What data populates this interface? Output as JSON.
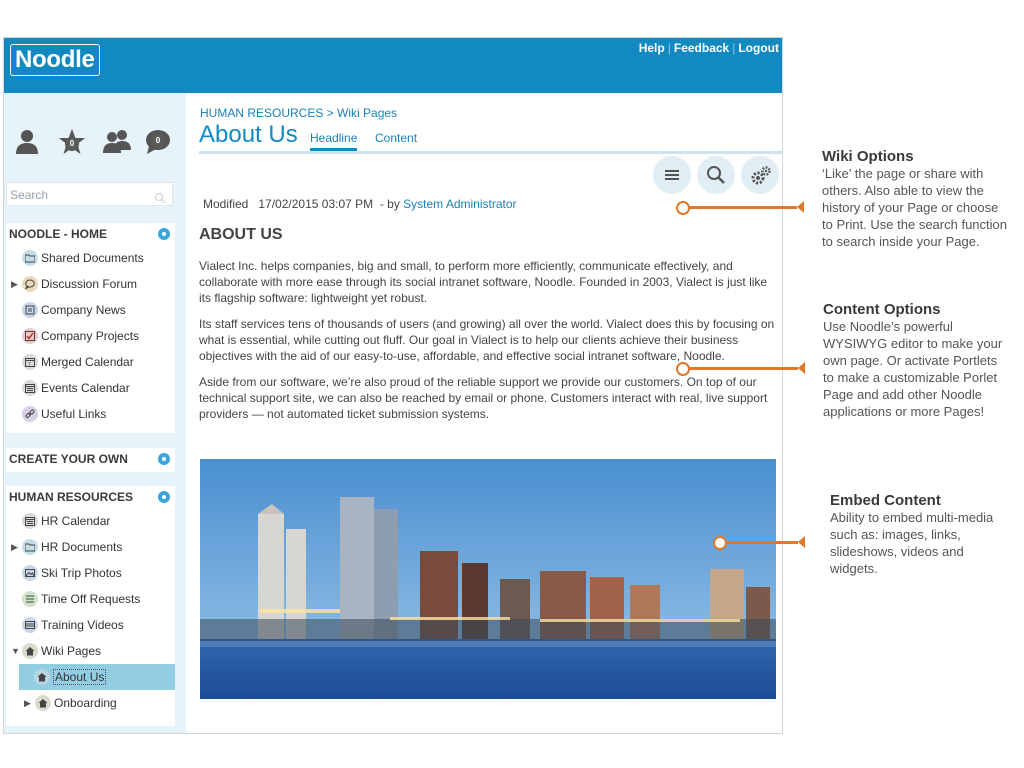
{
  "app": {
    "logo": "Noodle"
  },
  "header": {
    "links": [
      "Help",
      "Feedback",
      "Logout"
    ]
  },
  "sidebar": {
    "badges": [
      "0",
      "0"
    ],
    "search_placeholder": "Search",
    "sections": [
      {
        "title": "NOODLE - HOME",
        "items": [
          {
            "label": "Shared Documents",
            "icon": "folder-icon"
          },
          {
            "label": "Discussion Forum",
            "icon": "speech-bubble-icon"
          },
          {
            "label": "Company News",
            "icon": "newspaper-icon"
          },
          {
            "label": "Company Projects",
            "icon": "checkbox-icon"
          },
          {
            "label": "Merged Calendar",
            "icon": "calendar-icon"
          },
          {
            "label": "Events Calendar",
            "icon": "calendar-icon"
          },
          {
            "label": "Useful Links",
            "icon": "link-icon"
          }
        ]
      },
      {
        "title": "CREATE YOUR OWN",
        "items": []
      },
      {
        "title": "HUMAN RESOURCES",
        "items": [
          {
            "label": "HR Calendar",
            "icon": "calendar-icon"
          },
          {
            "label": "HR Documents",
            "icon": "folder-icon"
          },
          {
            "label": "Ski Trip Photos",
            "icon": "photo-icon"
          },
          {
            "label": "Time Off Requests",
            "icon": "list-icon"
          },
          {
            "label": "Training Videos",
            "icon": "video-icon"
          },
          {
            "label": "Wiki Pages",
            "icon": "home-icon"
          },
          {
            "label": "About Us",
            "icon": "home-icon"
          },
          {
            "label": "Onboarding",
            "icon": "home-icon"
          }
        ]
      }
    ]
  },
  "main": {
    "breadcrumb": "HUMAN RESOURCES > Wiki Pages",
    "title": "About Us",
    "tabs": [
      "Headline",
      "Content"
    ],
    "modified_label": "Modified",
    "modified_date": "17/02/2015 03:07 PM",
    "by_label": "-  by",
    "author": "System Administrator",
    "heading": "ABOUT US",
    "paragraphs": [
      "Vialect Inc. helps companies, big and small, to perform more efficiently, communicate effectively, and collaborate with more ease through its social intranet software, Noodle. Founded in 2003, Vialect is just like its flagship software: lightweight yet robust.",
      "Its staff services tens of thousands of users (and growing) all over the world. Vialect does this by focusing on what is essential, while cutting out fluff. Our goal in Vialect is to help our clients achieve their business objectives with the aid of our easy-to-use, affordable, and effective social intranet software, Noodle.",
      "Aside from our software, we’re also proud of the reliable support we provide our customers. On top of our technical support site, we can also be reached by email or phone. Customers interact with real, live support providers — not automated ticket submission systems."
    ]
  },
  "annotations": [
    {
      "title": "Wiki Options",
      "body": "‘Like’ the page or share with others. Also able to view the history of your Page or choose to Print. Use the search function to search inside your Page."
    },
    {
      "title": "Content Options",
      "body": "Use Noodle’s powerful WYSIWYG editor to make your own page. Or activate Portlets to make a customizable Porlet Page and add other Noodle applications or more Pages!"
    },
    {
      "title": "Embed Content",
      "body": "Ability to embed multi-media such as: images, links, slideshows, videos and widgets."
    }
  ],
  "colors": {
    "brand": "#1389c2",
    "callout": "#e07a2a",
    "sidebar_bg": "#e6f3f8",
    "selected": "#93cde4"
  }
}
